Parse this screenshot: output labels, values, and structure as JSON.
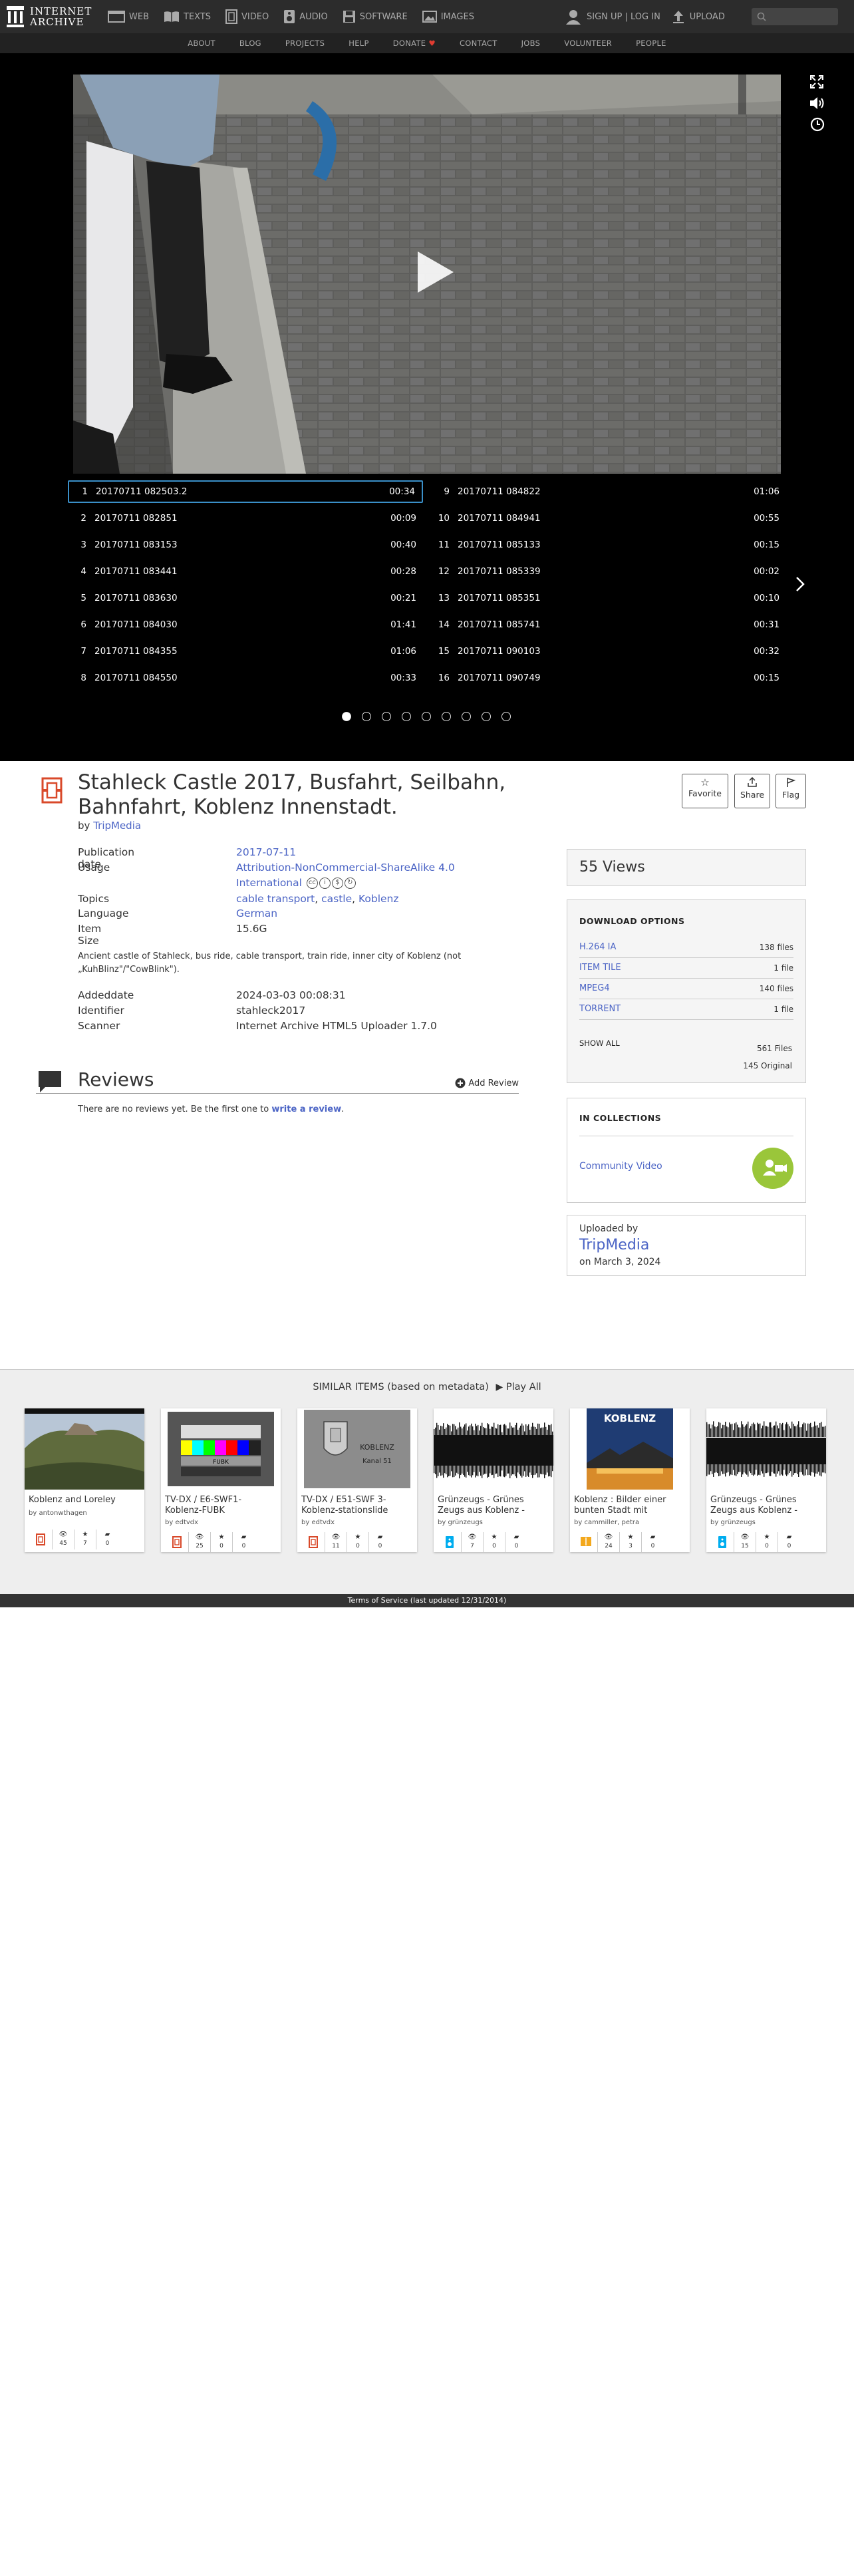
{
  "nav": {
    "logo_line1": "INTERNET",
    "logo_line2": "ARCHIVE",
    "items": [
      {
        "label": "WEB",
        "icon": "web-icon"
      },
      {
        "label": "TEXTS",
        "icon": "book-icon"
      },
      {
        "label": "VIDEO",
        "icon": "film-icon"
      },
      {
        "label": "AUDIO",
        "icon": "speaker-icon"
      },
      {
        "label": "SOFTWARE",
        "icon": "floppy-icon"
      },
      {
        "label": "IMAGES",
        "icon": "image-icon"
      }
    ],
    "signin": "SIGN UP | LOG IN",
    "upload": "UPLOAD"
  },
  "subnav": [
    "ABOUT",
    "BLOG",
    "PROJECTS",
    "HELP",
    "DONATE",
    "CONTACT",
    "JOBS",
    "VOLUNTEER",
    "PEOPLE"
  ],
  "playlist": {
    "left": [
      {
        "n": "1",
        "title": "20170711 082503.2",
        "dur": "00:34",
        "active": true
      },
      {
        "n": "2",
        "title": "20170711 082851",
        "dur": "00:09"
      },
      {
        "n": "3",
        "title": "20170711 083153",
        "dur": "00:40"
      },
      {
        "n": "4",
        "title": "20170711 083441",
        "dur": "00:28"
      },
      {
        "n": "5",
        "title": "20170711 083630",
        "dur": "00:21"
      },
      {
        "n": "6",
        "title": "20170711 084030",
        "dur": "01:41"
      },
      {
        "n": "7",
        "title": "20170711 084355",
        "dur": "01:06"
      },
      {
        "n": "8",
        "title": "20170711 084550",
        "dur": "00:33"
      }
    ],
    "right": [
      {
        "n": "9",
        "title": "20170711 084822",
        "dur": "01:06"
      },
      {
        "n": "10",
        "title": "20170711 084941",
        "dur": "00:55"
      },
      {
        "n": "11",
        "title": "20170711 085133",
        "dur": "00:15"
      },
      {
        "n": "12",
        "title": "20170711 085339",
        "dur": "00:02"
      },
      {
        "n": "13",
        "title": "20170711 085351",
        "dur": "00:10"
      },
      {
        "n": "14",
        "title": "20170711 085741",
        "dur": "00:31"
      },
      {
        "n": "15",
        "title": "20170711 090103",
        "dur": "00:32"
      },
      {
        "n": "16",
        "title": "20170711 090749",
        "dur": "00:15"
      }
    ],
    "pages": 9,
    "current_page": 1
  },
  "item": {
    "title": "Stahleck Castle 2017, Busfahrt, Seilbahn, Bahnfahrt, Koblenz Innenstadt.",
    "by_prefix": "by",
    "creator": "TripMedia",
    "actions": {
      "favorite": "Favorite",
      "share": "Share",
      "flag": "Flag"
    },
    "metadata": {
      "pubdate_label": "Publication date",
      "pubdate": "2017-07-11",
      "usage_label": "Usage",
      "usage_line1": "Attribution-NonCommercial-ShareAlike 4.0",
      "usage_line2": "International",
      "topics_label": "Topics",
      "topics": [
        "cable transport",
        "castle",
        "Koblenz"
      ],
      "language_label": "Language",
      "language": "German",
      "size_label": "Item Size",
      "size": "15.6G"
    },
    "description_line1": "Ancient castle of Stahleck, bus ride, cable transport, train ride, inner city of Koblenz (not",
    "description_line2": "„KuhBlinz\"/\"CowBlink\").",
    "addeddate_label": "Addeddate",
    "addeddate": "2024-03-03 00:08:31",
    "identifier_label": "Identifier",
    "identifier": "stahleck2017",
    "scanner_label": "Scanner",
    "scanner": "Internet Archive HTML5 Uploader 1.7.0"
  },
  "reviews": {
    "title": "Reviews",
    "add": "Add Review",
    "none_prefix": "There are no reviews yet. Be the first one to",
    "none_link": "write a review",
    "none_suffix": "."
  },
  "sidebar": {
    "views": "55 Views",
    "download_title": "DOWNLOAD OPTIONS",
    "downloads": [
      {
        "format": "H.264 IA",
        "count": "138 files"
      },
      {
        "format": "ITEM TILE",
        "count": "1 file"
      },
      {
        "format": "MPEG4",
        "count": "140 files"
      },
      {
        "format": "TORRENT",
        "count": "1 file"
      }
    ],
    "show_all": "SHOW ALL",
    "total_files": "561 Files",
    "original": "145 Original",
    "collections_title": "IN COLLECTIONS",
    "collection": "Community Video",
    "uploaded_by": "Uploaded by",
    "uploader": "TripMedia",
    "upload_date": "on March 3, 2024"
  },
  "similar": {
    "heading": "SIMILAR ITEMS (based on metadata)",
    "play_all": "Play All",
    "cards": [
      {
        "title": "Koblenz and Loreley",
        "by": "by antonwthagen",
        "views": "45",
        "favs": "7",
        "reviews": "0",
        "kind": "film-icon"
      },
      {
        "title": "TV-DX / E6-SWF1-Koblenz-FUBK",
        "by": "by edtvdx",
        "views": "25",
        "favs": "0",
        "reviews": "0",
        "kind": "film-icon"
      },
      {
        "title": "TV-DX / E51-SWF 3-Koblenz-stationslide",
        "by": "by edtvdx",
        "views": "11",
        "favs": "0",
        "reviews": "0",
        "kind": "film-icon"
      },
      {
        "title": "Grünzeugs - Grünes Zeugs aus Koblenz -",
        "by": "by grünzeugs",
        "views": "7",
        "favs": "0",
        "reviews": "0",
        "kind": "audio-icon"
      },
      {
        "title": "Koblenz : Bilder einer bunten Stadt mit",
        "by": "by cammiller, petra",
        "views": "24",
        "favs": "3",
        "reviews": "0",
        "kind": "book-icon"
      },
      {
        "title": "Grünzeugs - Grünes Zeugs aus Koblenz -",
        "by": "by grünzeugs",
        "views": "15",
        "favs": "0",
        "reviews": "0",
        "kind": "audio-icon"
      }
    ],
    "thumb4_text": "KOBLENZ",
    "thumb3_text1": "KOBLENZ",
    "thumb3_text2": "Kanal 51"
  },
  "footer": {
    "tos": "Terms of Service (last updated 12/31/2014)"
  },
  "colors": {
    "link": "#4b64c5",
    "active_row": "#3a8fc8",
    "donate_heart": "#e03c31",
    "collection_badge": "#9ac63a",
    "movie_icon": "#d9492a"
  }
}
